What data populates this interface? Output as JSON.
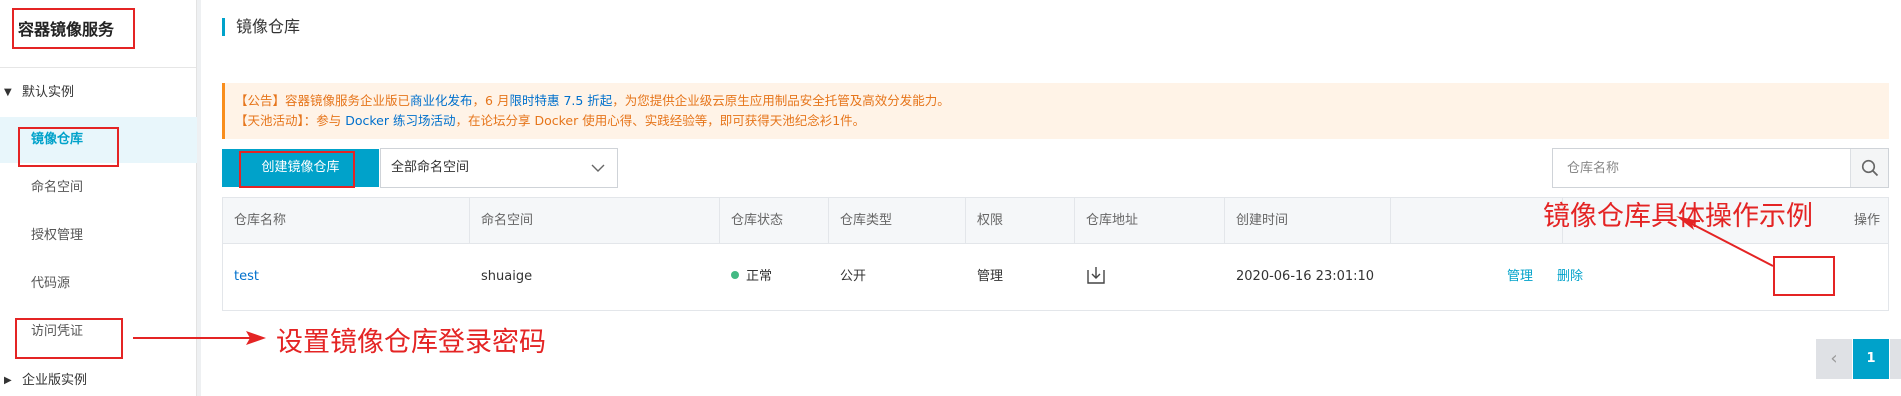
{
  "sidebar": {
    "title": "容器镜像服务",
    "groups": [
      {
        "label": "默认实例"
      },
      {
        "label": "企业版实例"
      }
    ],
    "items": [
      {
        "label": "镜像仓库"
      },
      {
        "label": "命名空间"
      },
      {
        "label": "授权管理"
      },
      {
        "label": "代码源"
      },
      {
        "label": "访问凭证"
      }
    ]
  },
  "page": {
    "title": "镜像仓库"
  },
  "notice": {
    "line1_a": "【公告】容器镜像服务企业版已",
    "line1_link1": "商业化发布",
    "line1_b": "，6 月",
    "line1_link2": "限时特惠 7.5 折起",
    "line1_c": "，为您提供企业级云原生应用制品安全托管及高效分发能力。",
    "line2_a": "【天池活动】：参与 ",
    "line2_link": "Docker 练习场活动",
    "line2_b": "，在论坛分享 Docker 使用心得、实践经验等，即可获得天池纪念衫1件。"
  },
  "toolbar": {
    "create_label": "创建镜像仓库",
    "namespace_selected": "全部命名空间",
    "search_placeholder": "仓库名称"
  },
  "table": {
    "columns": [
      "仓库名称",
      "命名空间",
      "仓库状态",
      "仓库类型",
      "权限",
      "仓库地址",
      "创建时间",
      "",
      "操作"
    ],
    "rows": [
      {
        "name": "test",
        "namespace": "shuaige",
        "status": "正常",
        "type": "公开",
        "permission": "管理",
        "address_icon": "download-icon",
        "created": "2020-06-16 23:01:10",
        "action_manage": "管理",
        "action_delete": "删除"
      }
    ]
  },
  "pagination": {
    "current": "1",
    "prev_glyph": "‹",
    "next_glyph": "›"
  },
  "annotations": {
    "credential_note": "设置镜像仓库登录密码",
    "operation_note": "镜像仓库具体操作示例",
    "color": "#e42424"
  },
  "colors": {
    "accent": "#00a2ca",
    "notice_text": "#e6751b",
    "link": "#0070cc",
    "status_ok": "#42b983"
  }
}
